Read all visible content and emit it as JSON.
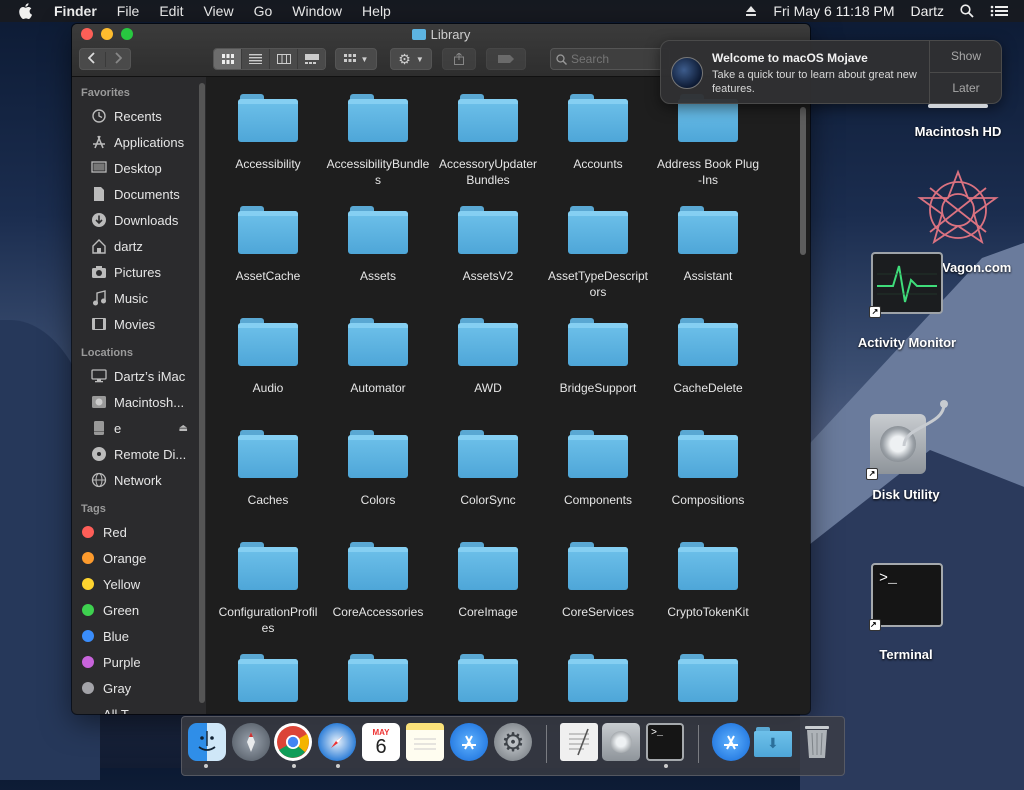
{
  "menubar": {
    "app": "Finder",
    "items": [
      "File",
      "Edit",
      "View",
      "Go",
      "Window",
      "Help"
    ],
    "clock": "Fri May 6  11:18 PM",
    "user": "Dartz"
  },
  "window": {
    "title": "Library",
    "search_placeholder": "Search"
  },
  "sidebar": {
    "favorites_title": "Favorites",
    "favorites": [
      {
        "label": "Recents",
        "icon": "clock-icon"
      },
      {
        "label": "Applications",
        "icon": "applications-icon"
      },
      {
        "label": "Desktop",
        "icon": "desktop-icon"
      },
      {
        "label": "Documents",
        "icon": "document-icon"
      },
      {
        "label": "Downloads",
        "icon": "download-icon"
      },
      {
        "label": "dartz",
        "icon": "home-icon"
      },
      {
        "label": "Pictures",
        "icon": "camera-icon"
      },
      {
        "label": "Music",
        "icon": "music-note-icon"
      },
      {
        "label": "Movies",
        "icon": "film-icon"
      }
    ],
    "locations_title": "Locations",
    "locations": [
      {
        "label": "Dartz’s iMac",
        "icon": "imac-icon"
      },
      {
        "label": "Macintosh...",
        "icon": "hard-drive-icon"
      },
      {
        "label": "e",
        "icon": "disk-icon"
      },
      {
        "label": "Remote Di...",
        "icon": "optical-disc-icon"
      },
      {
        "label": "Network",
        "icon": "network-globe-icon"
      }
    ],
    "tags_title": "Tags",
    "tags": [
      {
        "label": "Red",
        "color": "#fe5e58"
      },
      {
        "label": "Orange",
        "color": "#fd9b2d"
      },
      {
        "label": "Yellow",
        "color": "#ffd42f"
      },
      {
        "label": "Green",
        "color": "#3ed14f"
      },
      {
        "label": "Blue",
        "color": "#3a8dfb"
      },
      {
        "label": "Purple",
        "color": "#c864db"
      },
      {
        "label": "Gray",
        "color": "#a3a3a8"
      },
      {
        "label": "All T...",
        "color": ""
      }
    ]
  },
  "folders": [
    "Accessibility",
    "AccessibilityBundles",
    "AccessoryUpdaterBundles",
    "Accounts",
    "Address Book Plug-Ins",
    "AssetCache",
    "Assets",
    "AssetsV2",
    "AssetTypeDescriptors",
    "Assistant",
    "Audio",
    "Automator",
    "AWD",
    "BridgeSupport",
    "CacheDelete",
    "Caches",
    "Colors",
    "ColorSync",
    "Components",
    "Compositions",
    "ConfigurationProfiles",
    "CoreAccessories",
    "CoreImage",
    "CoreServices",
    "CryptoTokenKit",
    "",
    "",
    "",
    "",
    ""
  ],
  "notification": {
    "title": "Welcome to macOS Mojave",
    "body": "Take a quick tour to learn about great new features.",
    "show": "Show",
    "later": "Later"
  },
  "desktop": {
    "macintosh_hd": "Macintosh HD",
    "wagon": "Vagon.com",
    "activity_monitor": "Activity Monitor",
    "disk_utility": "Disk Utility",
    "terminal": "Terminal"
  },
  "dock": {
    "calendar_month": "MAY",
    "calendar_day": "6",
    "terminal_prompt": ">_"
  },
  "colors": {
    "folder": "#5db4e2",
    "sidebar_bg": "#2b2b2d",
    "content_bg": "#1e1e1e"
  }
}
